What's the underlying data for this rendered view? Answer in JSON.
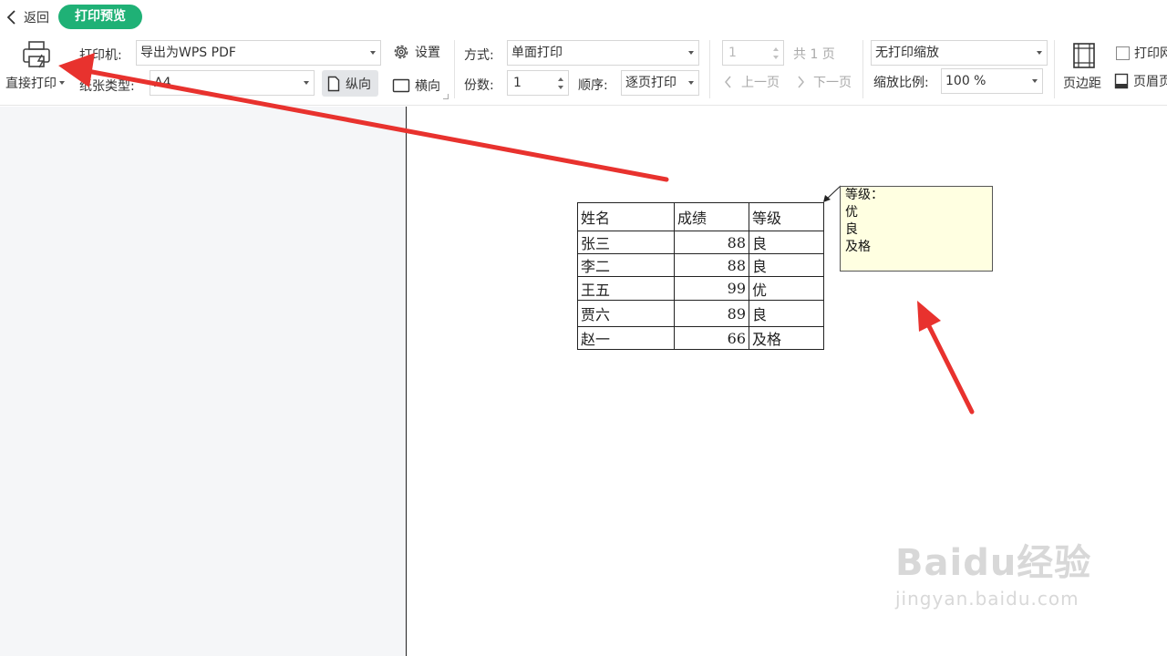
{
  "header": {
    "back_label": "返回",
    "mode_badge": "打印预览"
  },
  "toolbar": {
    "direct_print_label": "直接打印",
    "printer_label": "打印机:",
    "printer_value": "导出为WPS PDF",
    "paper_type_label": "纸张类型:",
    "paper_type_value": "A4",
    "settings_label": "设置",
    "portrait_label": "纵向",
    "landscape_label": "横向",
    "mode_label": "方式:",
    "mode_value": "单面打印",
    "copies_label": "份数:",
    "copies_value": "1",
    "order_label": "顺序:",
    "order_value": "逐页打印",
    "page_value": "1",
    "total_pages": "共 1 页",
    "prev_page": "上一页",
    "next_page": "下一页",
    "scaling_value": "无打印缩放",
    "zoom_label": "缩放比例:",
    "zoom_value": "100 %",
    "margins_label": "页边距",
    "print_grid_label": "打印网",
    "header_footer_label": "页眉页"
  },
  "sheet": {
    "headers": [
      "姓名",
      "成绩",
      "等级"
    ],
    "rows": [
      [
        "张三",
        "88",
        "良"
      ],
      [
        "李二",
        "88",
        "良"
      ],
      [
        "王五",
        "99",
        "优"
      ],
      [
        "贾六",
        "89",
        "良"
      ],
      [
        "赵一",
        "66",
        "及格"
      ]
    ]
  },
  "comment": {
    "lines": [
      "等级：",
      "优",
      "良",
      "及格"
    ]
  },
  "watermark": {
    "brand": "Baidu经验",
    "url": "jingyan.baidu.com"
  },
  "colors": {
    "accent_green": "#1fb176",
    "arrow_red": "#e8322e",
    "note_bg": "#ffffe1"
  },
  "icons": [
    "chevron-left-icon",
    "printer-icon",
    "gear-icon",
    "page-portrait-icon",
    "page-landscape-icon",
    "margins-icon",
    "header-footer-icon"
  ]
}
